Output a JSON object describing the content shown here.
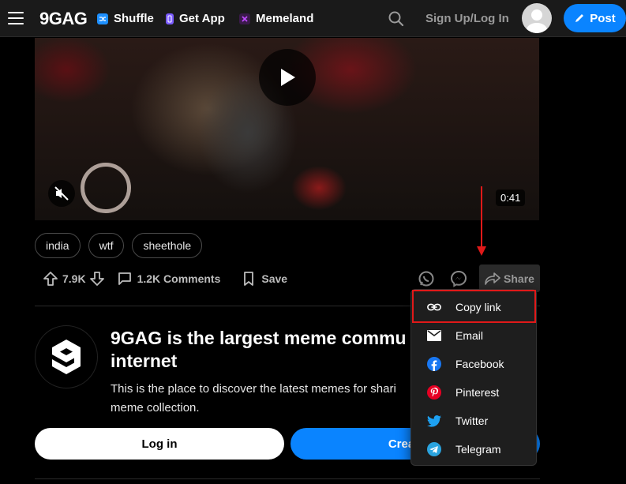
{
  "header": {
    "logo": "9GAG",
    "nav": [
      {
        "label": "Shuffle",
        "icon": "shuffle-icon",
        "color": "#1e90ff"
      },
      {
        "label": "Get App",
        "icon": "phone-icon",
        "color": "#7b5cff"
      },
      {
        "label": "Memeland",
        "icon": "memeland-icon",
        "color": "#c04bff"
      }
    ],
    "signup": "Sign Up/Log In",
    "post": "Post"
  },
  "video": {
    "duration": "0:41"
  },
  "tags": [
    "india",
    "wtf",
    "sheethole"
  ],
  "actions": {
    "upvotes": "7.9K",
    "comments": "1.2K Comments",
    "save": "Save",
    "share": "Share"
  },
  "share_menu": [
    {
      "label": "Copy link",
      "icon": "link-icon"
    },
    {
      "label": "Email",
      "icon": "email-icon"
    },
    {
      "label": "Facebook",
      "icon": "facebook-icon"
    },
    {
      "label": "Pinterest",
      "icon": "pinterest-icon"
    },
    {
      "label": "Twitter",
      "icon": "twitter-icon"
    },
    {
      "label": "Telegram",
      "icon": "telegram-icon"
    }
  ],
  "promo": {
    "title": "9GAG is the largest meme commu",
    "title2": "internet",
    "text": "This is the place to discover the latest memes for shari",
    "text2": "meme collection.",
    "login": "Log in",
    "create": "Create ne"
  },
  "colors": {
    "accent": "#0a84ff",
    "annotation": "#e01919"
  }
}
